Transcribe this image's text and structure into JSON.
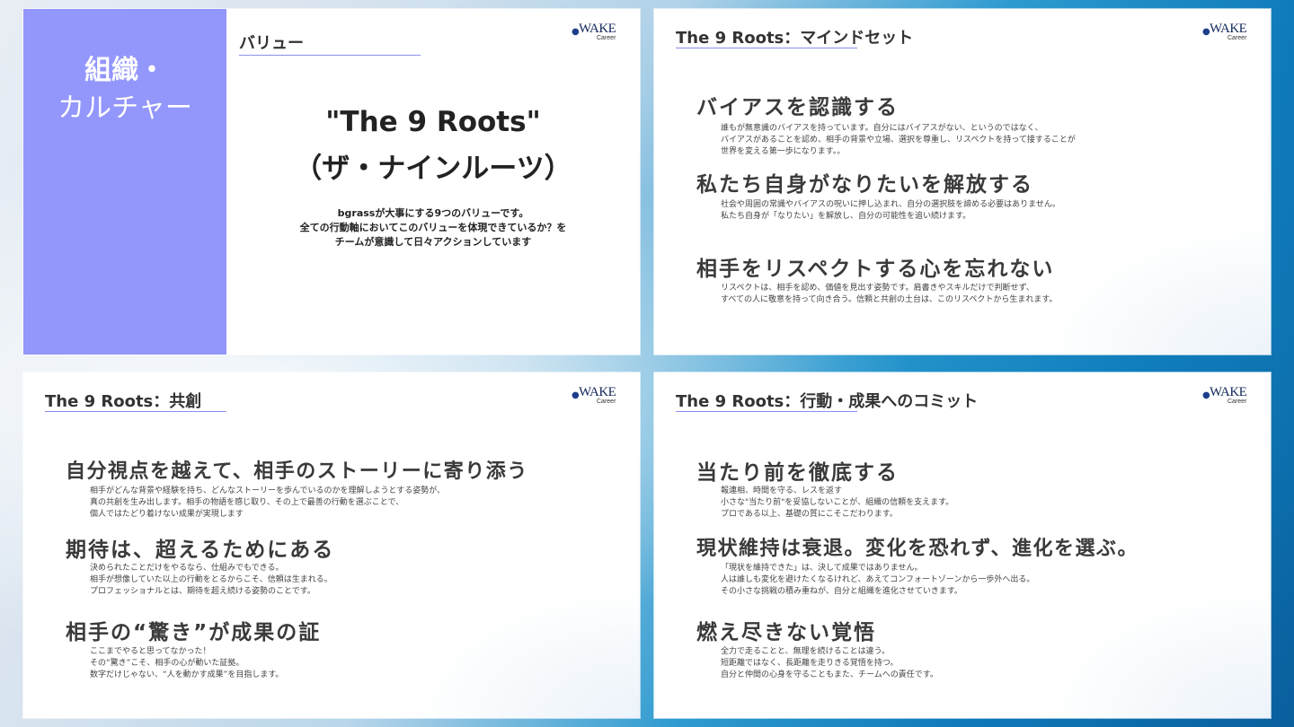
{
  "slide1": {
    "side_line1": "組織・",
    "side_line2": "カルチャー",
    "header": "バリュー",
    "title_line1": "\"The 9 Roots\"",
    "title_line2": "（ザ・ナインルーツ）",
    "desc_lines": [
      "bgrassが大事にする9つのバリューです。",
      "全ての行動軸においてこのバリューを体現できているか？を",
      "チームが意識して日々アクションしています"
    ]
  },
  "logo": {
    "word": "WAKE",
    "sub": "Career"
  },
  "slide2": {
    "header": "The 9 Roots：マインドセット",
    "items": [
      {
        "title": "バイアスを認識する",
        "lines": [
          "誰もが無意識のバイアスを持っています。自分にはバイアスがない、というのではなく、",
          "バイアスがあることを認め、相手の背景や立場、選択を尊重し、リスペクトを持って接することが",
          "世界を変える第一歩になります。。"
        ]
      },
      {
        "title": "私たち自身がなりたいを解放する",
        "lines": [
          "社会や周囲の常識やバイアスの呪いに押し込まれ、自分の選択肢を諦める必要はありません。",
          "私たち自身が「なりたい」を解放し、自分の可能性を追い続けます。"
        ]
      },
      {
        "title": "相手をリスペクトする心を忘れない",
        "lines": [
          "リスペクトは、相手を認め、価値を見出す姿勢です。肩書きやスキルだけで判断せず、",
          "すべての人に敬意を持って向き合う。信頼と共創の土台は、このリスペクトから生まれます。"
        ]
      }
    ]
  },
  "slide3": {
    "header": "The 9 Roots：共創",
    "items": [
      {
        "title": "自分視点を越えて、相手のストーリーに寄り添う",
        "lines": [
          "相手がどんな背景や経験を持ち、どんなストーリーを歩んでいるのかを理解しようとする姿勢が、",
          "真の共創を生み出します。相手の物語を感じ取り、その上で最善の行動を選ぶことで、",
          "個人ではたどり着けない成果が実現します"
        ]
      },
      {
        "title": "期待は、超えるためにある",
        "lines": [
          "決められたことだけをやるなら、仕組みでもできる。",
          "相手が想像していた以上の行動をとるからこそ、信頼は生まれる。",
          "プロフェッショナルとは、期待を超え続ける姿勢のことです。"
        ]
      },
      {
        "title": "相手の“驚き”が成果の証",
        "lines": [
          "ここまでやると思ってなかった！",
          "その“驚き”こそ、相手の心が動いた証拠。",
          "数字だけじゃない、“人を動かす成果”を目指します。"
        ]
      }
    ]
  },
  "slide4": {
    "header": "The 9 Roots：行動・成果へのコミット",
    "items": [
      {
        "title": "当たり前を徹底する",
        "lines": [
          "報連相、時間を守る、レスを返す",
          "小さな\"当たり前\"を妥協しないことが、組織の信頼を支えます。",
          "プロである以上、基礎の質にこそこだわります。"
        ]
      },
      {
        "title": "現状維持は衰退。変化を恐れず、進化を選ぶ。",
        "lines": [
          "「現状を維持できた」は、決して成果ではありません。",
          "人は誰しも変化を避けたくなるけれど、あえてコンフォートゾーンから一歩外へ出る。",
          "その小さな挑戦の積み重ねが、自分と組織を進化させていきます。"
        ]
      },
      {
        "title": "燃え尽きない覚悟",
        "lines": [
          "全力で走ることと、無理を続けることは違う。",
          "短距離ではなく、長距離を走りきる覚悟を持つ。",
          "自分と仲間の心身を守ることもまた、チームへの責任です。"
        ]
      }
    ]
  }
}
